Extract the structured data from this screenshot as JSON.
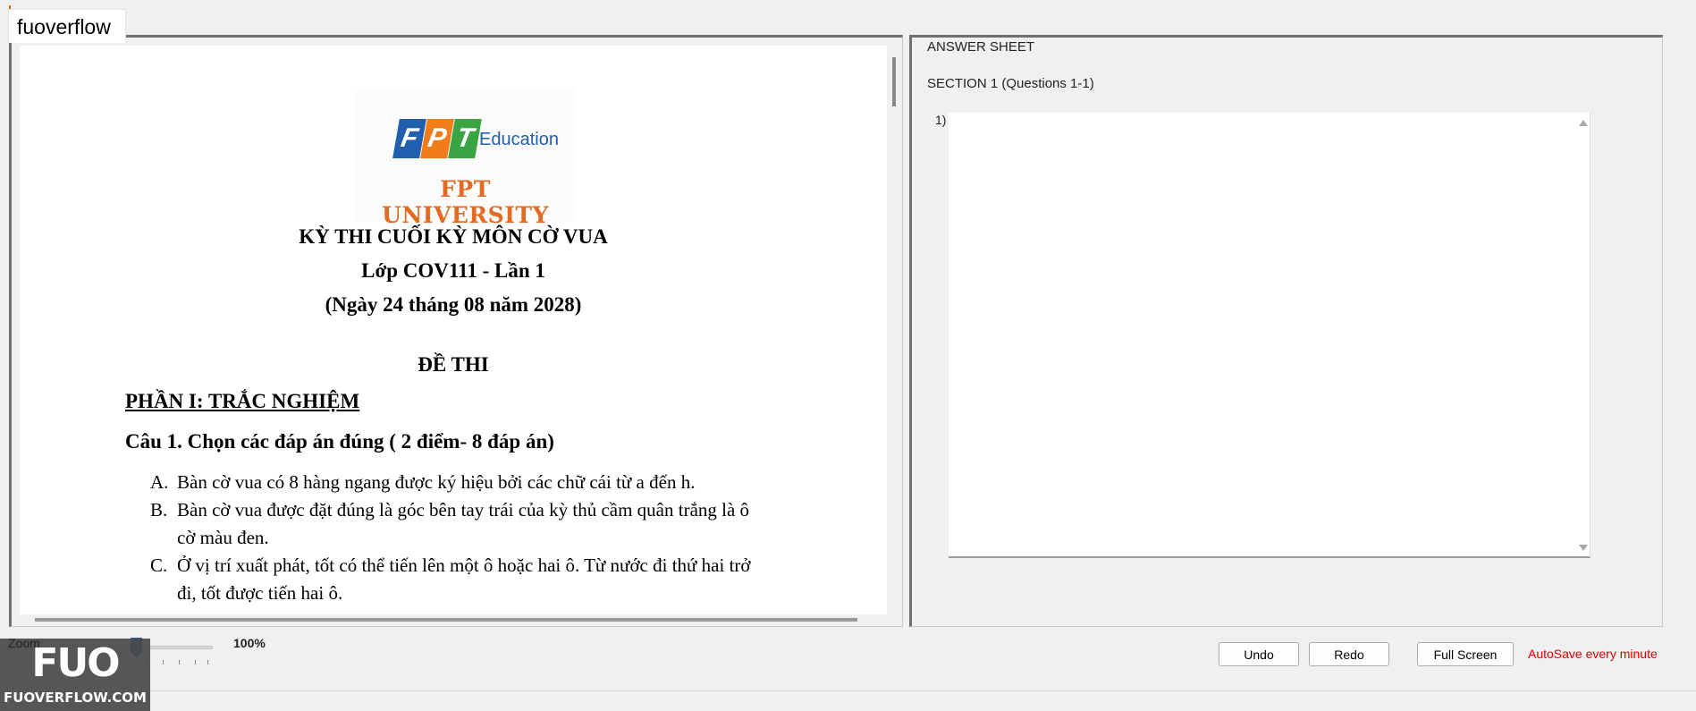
{
  "tab": {
    "title": "fuoverflow"
  },
  "document": {
    "logo": {
      "brand_letters": [
        "F",
        "P",
        "T"
      ],
      "sub_label": "Education",
      "university": "FPT UNIVERSITY"
    },
    "title_line1": "KỲ THI CUỐI KỲ MÔN CỜ VUA",
    "title_line2": "Lớp COV111 - Lần 1",
    "title_line3": "(Ngày 24 tháng 08 năm 2028)",
    "exam_heading": "ĐỀ THI",
    "part_heading": "PHẦN I: TRẮC NGHIỆM",
    "question1": "Câu 1. Chọn các đáp án đúng ( 2 điểm- 8 đáp án)",
    "options": [
      {
        "letter": "A.",
        "lines": [
          "Bàn cờ vua có 8 hàng ngang được ký hiệu bởi các chữ cái từ a đến h."
        ]
      },
      {
        "letter": "B.",
        "lines": [
          "Bàn cờ vua được đặt đúng là góc bên tay trái của kỳ thủ cầm quân trắng là ô",
          "cờ màu đen."
        ]
      },
      {
        "letter": "C.",
        "lines": [
          "Ở vị trí xuất phát, tốt có thể tiến lên một ô hoặc hai ô. Từ nước đi thứ hai trở",
          "đi, tốt được tiến hai ô."
        ]
      }
    ]
  },
  "answer_sheet": {
    "title": "ANSWER SHEET",
    "section": "SECTION 1 (Questions 1-1)",
    "question_label": "1)",
    "answer_value": ""
  },
  "toolbar": {
    "zoom_label": "Zoom",
    "zoom_value": "100%",
    "undo": "Undo",
    "redo": "Redo",
    "fullscreen": "Full Screen",
    "autosave": "AutoSave every minute"
  },
  "watermark": {
    "logo_text": "FUO",
    "site": "FUOVERFLOW.COM"
  },
  "colors": {
    "accent": "#1f5fad",
    "autosave": "#e00000",
    "university": "#e26a22"
  }
}
